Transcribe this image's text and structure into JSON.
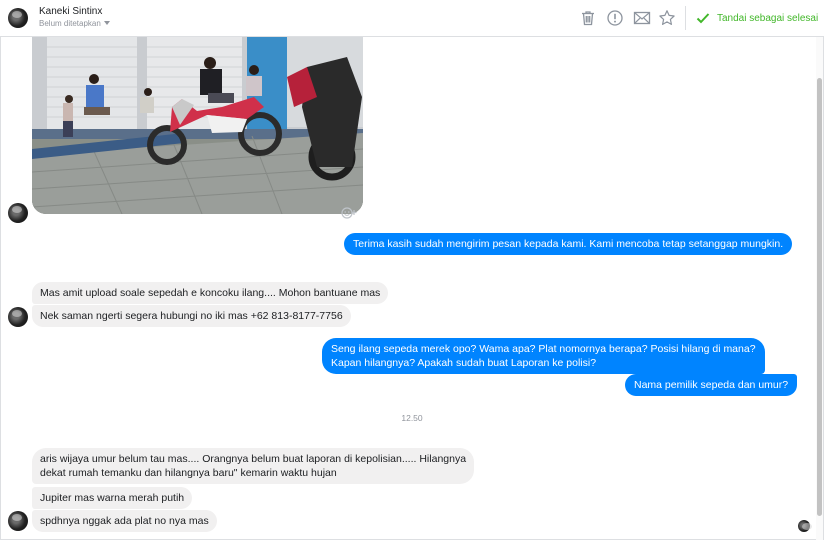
{
  "header": {
    "contact_name": "Kaneki Sintinx",
    "status_label": "Belum ditetapkan",
    "icons": [
      "trash-icon",
      "alert-icon",
      "mail-icon",
      "star-icon"
    ],
    "resolve_label": "Tandai sebagai selesai"
  },
  "conversation": {
    "image_message": {
      "icon": "reaction-icon"
    },
    "messages": [
      {
        "from": "page",
        "text": "Terima kasih sudah mengirim pesan kepada kami. Kami mencoba tetap setanggap mungkin."
      },
      {
        "from": "user",
        "text": "Mas amit upload soale sepedah e koncoku ilang.... Mohon bantuane mas"
      },
      {
        "from": "user",
        "text": "Nek saman ngerti segera hubungi no iki mas +62 813-8177-7756"
      },
      {
        "from": "page",
        "line1": "Seng ilang sepeda merek opo? Wama apa? Plat nomornya berapa? Posisi hilang di mana?",
        "line2": "Kapan hilangnya? Apakah sudah buat Laporan ke polisi?"
      },
      {
        "from": "page",
        "text": "Nama pemilik sepeda dan umur?"
      },
      {
        "from": "user",
        "line1": "aris wijaya umur belum tau mas.... Orangnya belum buat laporan di kepolisian..... Hilangnya",
        "line2": "dekat rumah temanku dan hilangnya baru\" kemarin waktu hujan"
      },
      {
        "from": "user",
        "text": "Jupiter  mas warna merah putih"
      },
      {
        "from": "user",
        "text": "spdhnya nggak ada plat no nya mas"
      }
    ],
    "timestamp": "12.50"
  },
  "colors": {
    "outgoing_bubble": "#0084ff",
    "incoming_bubble": "#f1f0f0",
    "resolve_green": "#42b72a"
  }
}
